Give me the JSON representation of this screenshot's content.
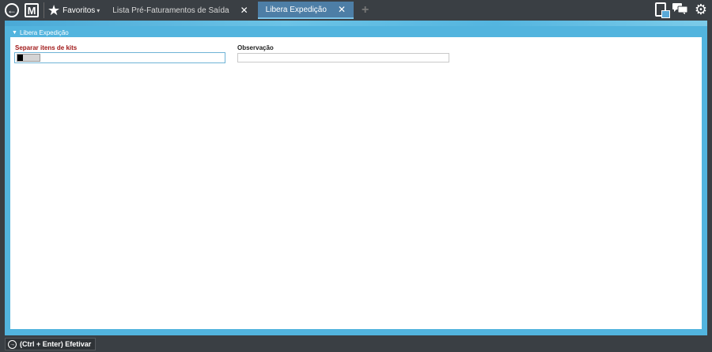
{
  "topbar": {
    "favorites_label": "Favoritos",
    "favorites_caret": "▾",
    "tabs": [
      {
        "label": "Lista Pré-Faturamentos de Saída",
        "close": "✕"
      },
      {
        "label": "Libera Expedição",
        "close": "✕"
      }
    ],
    "add_tab": "+"
  },
  "icons": {
    "back": "back-icon",
    "app": "m-logo-icon",
    "favorites": "star-icon",
    "clipboard": "clipboard-icon",
    "chat": "chat-icon",
    "settings": "gear-icon"
  },
  "glyphs": {
    "back": "←",
    "app": "M",
    "star": "★",
    "chat": "💬",
    "gear": "⚙",
    "tri": "▼",
    "action": "→"
  },
  "panel": {
    "title": "Libera Expedição"
  },
  "form": {
    "field1_label": "Separar itens de kits",
    "field2_label": "Observação",
    "field2_value": ""
  },
  "bottombar": {
    "action_label": "(Ctrl + Enter) Efetivar"
  },
  "colors": {
    "accent": "#52b4de",
    "active_tab": "#4d7ea6",
    "required_label": "#a01818",
    "chrome": "#3a3f44"
  }
}
